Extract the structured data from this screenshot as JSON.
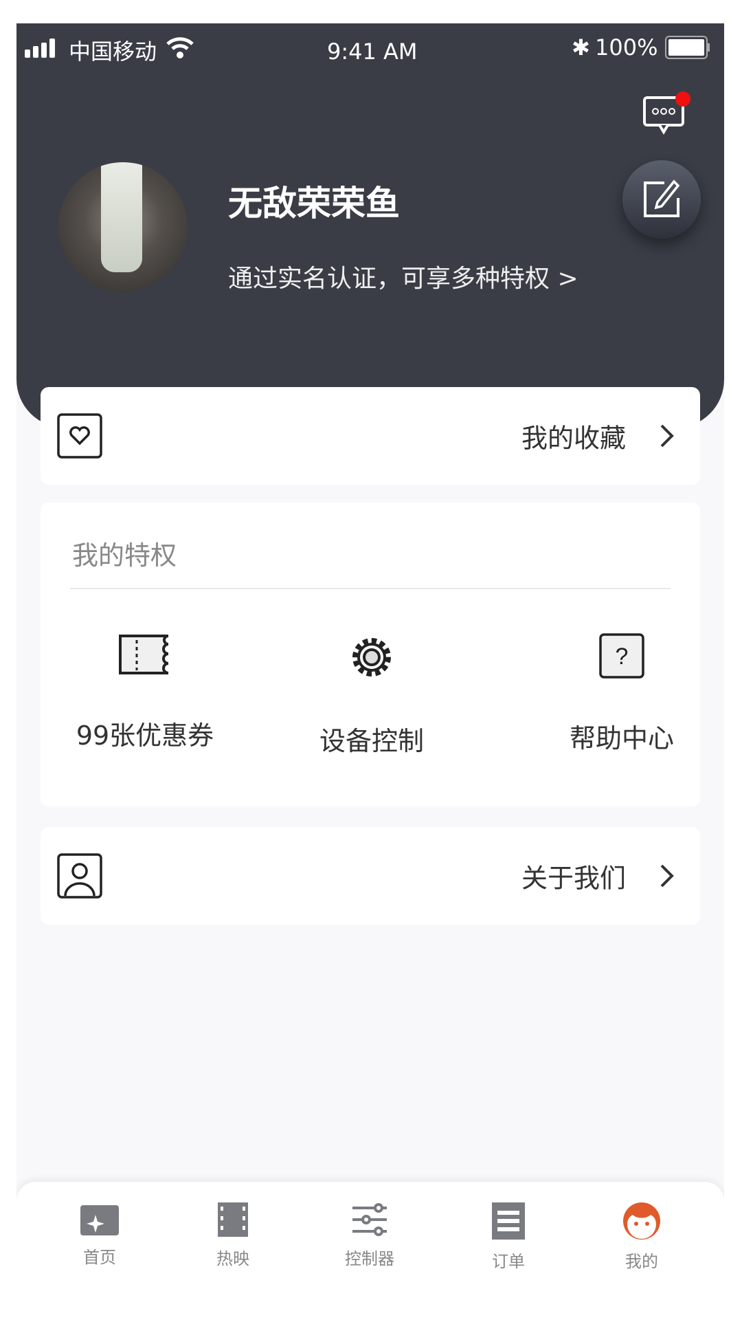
{
  "status_bar": {
    "carrier": "中国移动",
    "time": "9:41 AM",
    "battery": "100%"
  },
  "profile": {
    "name": "无敌荣荣鱼",
    "verify_prompt": "通过实名认证，可享多种特权 >",
    "has_unread_messages": true
  },
  "favorites": {
    "label": "我的收藏"
  },
  "privileges": {
    "title": "我的特权",
    "items": [
      {
        "label": "99张优惠券",
        "icon": "coupon-icon"
      },
      {
        "label": "设备控制",
        "icon": "gear-icon"
      },
      {
        "label": "帮助中心",
        "icon": "help-icon"
      }
    ]
  },
  "about": {
    "label": "关于我们"
  },
  "tabbar": {
    "active": "我的",
    "accent": "#e05a2b",
    "items": [
      {
        "label": "首页"
      },
      {
        "label": "热映"
      },
      {
        "label": "控制器"
      },
      {
        "label": "订单"
      },
      {
        "label": "我的"
      }
    ]
  }
}
